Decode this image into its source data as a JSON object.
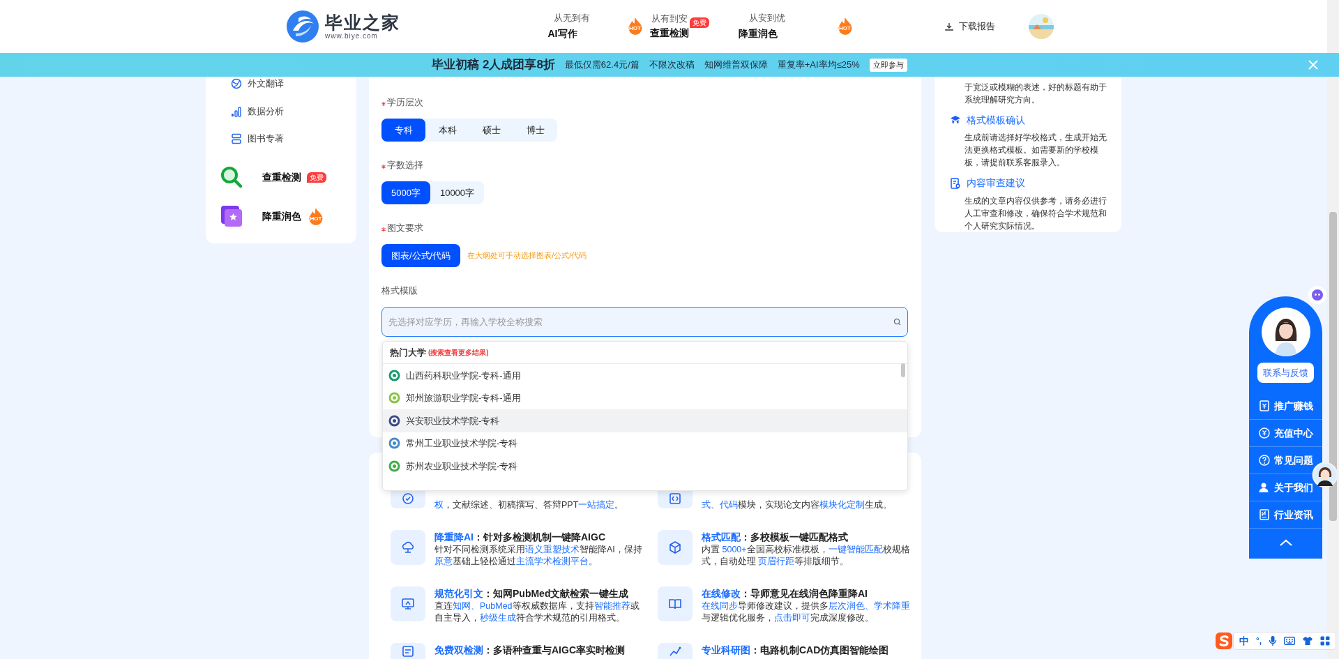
{
  "header": {
    "logo": {
      "name": "毕业之家",
      "url": "www.biye.com"
    },
    "nav": [
      {
        "caption": "从无到有",
        "label": "AI写作",
        "badge": {
          "kind": "hot",
          "text": "HOT"
        }
      },
      {
        "caption": "从有到安",
        "label": "查重检测",
        "badge": {
          "kind": "free",
          "text": "免费"
        }
      },
      {
        "caption": "从安到优",
        "label": "降重润色",
        "badge": {
          "kind": "hot",
          "text": "HOT"
        }
      }
    ],
    "download": "下载报告"
  },
  "banner": {
    "headline": "毕业初稿 2人成团享8折",
    "perks": [
      "最低仅需62.4元/篇",
      "不限次改稿",
      "知网维普双保障",
      "重复率+AI率均≤25%"
    ],
    "cta": "立即参与"
  },
  "sidebar": {
    "items": [
      {
        "kind": "small",
        "label": "外文翻译"
      },
      {
        "kind": "small",
        "label": "数据分析"
      },
      {
        "kind": "small",
        "label": "图书专著"
      },
      {
        "kind": "large",
        "label": "查重检测",
        "badge": {
          "kind": "free",
          "text": "免费"
        }
      },
      {
        "kind": "large",
        "label": "降重润色",
        "badge": {
          "kind": "hot",
          "text": "HOT"
        }
      }
    ]
  },
  "form": {
    "fields": [
      {
        "kind": "segmented",
        "label": "学历层次",
        "required": true,
        "options": [
          {
            "label": "专科",
            "selected": true
          },
          {
            "label": "本科",
            "selected": false
          },
          {
            "label": "硕士",
            "selected": false
          },
          {
            "label": "博士",
            "selected": false
          }
        ]
      },
      {
        "kind": "segmented",
        "label": "字数选择",
        "required": true,
        "options": [
          {
            "label": "5000字",
            "selected": true
          },
          {
            "label": "10000字",
            "selected": false
          }
        ]
      },
      {
        "kind": "segmented",
        "label": "图文要求",
        "required": true,
        "options": [
          {
            "label": "图表/公式/代码",
            "selected": true
          }
        ],
        "hint": "在大纲处可手动选择图表/公式/代码"
      },
      {
        "kind": "search",
        "label": "格式模版",
        "required": false,
        "placeholder": "先选择对应学历，再输入学校全称搜索"
      }
    ]
  },
  "dropdown": {
    "heading": "热门大学",
    "note": "(搜索查看更多结果)",
    "items": [
      {
        "label": "山西药科职业学院-专科-通用",
        "selected": false
      },
      {
        "label": "郑州旅游职业学院-专科-通用",
        "selected": false
      },
      {
        "label": "兴安职业技术学院-专科",
        "selected": true
      },
      {
        "label": "常州工业职业技术学院-专科",
        "selected": false
      },
      {
        "label": "苏州农业职业技术学院-专科",
        "selected": false
      }
    ]
  },
  "features": [
    {
      "desc": [
        {
          "text": "权",
          "highlight": true
        },
        {
          "text": "，文献综述、初稿撰写、答辩PPT",
          "highlight": false
        },
        {
          "text": "一站搞定",
          "highlight": true
        },
        {
          "text": "。",
          "highlight": false
        }
      ]
    },
    {
      "desc": [
        {
          "text": "式、代码",
          "highlight": true
        },
        {
          "text": "模块，实现论文内容",
          "highlight": false
        },
        {
          "text": "模块化定制",
          "highlight": true
        },
        {
          "text": "生成。",
          "highlight": false
        }
      ]
    },
    {
      "title": [
        {
          "text": "降重降AI",
          "highlight": true
        },
        {
          "text": "：针对多检测机制一键降AIGC",
          "highlight": false
        }
      ],
      "desc": [
        {
          "text": "针对不同检测系统采用",
          "highlight": false
        },
        {
          "text": "语义重塑技术",
          "highlight": true
        },
        {
          "text": "智能降AI，保持",
          "highlight": false
        },
        {
          "text": "原意",
          "highlight": true
        },
        {
          "text": "基础上轻松通过",
          "highlight": false
        },
        {
          "text": "主流学术检测平台",
          "highlight": true
        },
        {
          "text": "。",
          "highlight": false
        }
      ]
    },
    {
      "title": [
        {
          "text": "格式匹配",
          "highlight": true
        },
        {
          "text": "：多校模板一键匹配格式",
          "highlight": false
        }
      ],
      "desc": [
        {
          "text": "内置 ",
          "highlight": false
        },
        {
          "text": "5000+",
          "highlight": true
        },
        {
          "text": "全国高校标准模板，",
          "highlight": false
        },
        {
          "text": "一键智能匹配",
          "highlight": true
        },
        {
          "text": "校规格式，自动处理 ",
          "highlight": false
        },
        {
          "text": "页眉行距",
          "highlight": true
        },
        {
          "text": "等排版细节。",
          "highlight": false
        }
      ]
    },
    {
      "title": [
        {
          "text": "规范化引文",
          "highlight": true
        },
        {
          "text": "：知网PubMed文献检索一键生成",
          "highlight": false
        }
      ],
      "desc": [
        {
          "text": "直连",
          "highlight": false
        },
        {
          "text": "知网、PubMed",
          "highlight": true
        },
        {
          "text": "等权威数据库，支持",
          "highlight": false
        },
        {
          "text": "智能推荐",
          "highlight": true
        },
        {
          "text": "或自主导入，",
          "highlight": false
        },
        {
          "text": "秒级生成",
          "highlight": true
        },
        {
          "text": "符合学术规范的引用格式。",
          "highlight": false
        }
      ]
    },
    {
      "title": [
        {
          "text": "在线修改",
          "highlight": true
        },
        {
          "text": "：导师意见在线润色降重降AI",
          "highlight": false
        }
      ],
      "desc": [
        {
          "text": "在线同步",
          "highlight": true
        },
        {
          "text": "导师修改建议，提供多",
          "highlight": false
        },
        {
          "text": "层次润色、学术降重",
          "highlight": true
        },
        {
          "text": "与逻辑优化服务，",
          "highlight": false
        },
        {
          "text": "点击即可",
          "highlight": true
        },
        {
          "text": "完成深度修改。",
          "highlight": false
        }
      ]
    },
    {
      "title": [
        {
          "text": "免费双检测",
          "highlight": true
        },
        {
          "text": "：多语种查重与AIGC率实时检测",
          "highlight": false
        }
      ]
    },
    {
      "title": [
        {
          "text": "专业科研图",
          "highlight": true
        },
        {
          "text": "：电路机制CAD仿真图智能绘图",
          "highlight": false
        }
      ]
    }
  ],
  "tips": {
    "intro": "于宽泛或模糊的表述，好的标题有助于系统理解研究方向。",
    "sections": [
      {
        "title": "格式模板确认",
        "text": "生成前请选择好学校格式，生成开始无法更换格式模板。如需要新的学校模板，请提前联系客服录入。"
      },
      {
        "title": "内容审查建议",
        "text": "生成的文章内容仅供参考，请务必进行人工审查和修改，确保符合学术规范和个人研究实际情况。"
      }
    ]
  },
  "widget": {
    "contact": "联系与反馈",
    "items": [
      "推广赚钱",
      "充值中心",
      "常见问题",
      "关于我们",
      "行业资讯"
    ]
  },
  "ime": {
    "mode": "中",
    "punct": "°,"
  }
}
